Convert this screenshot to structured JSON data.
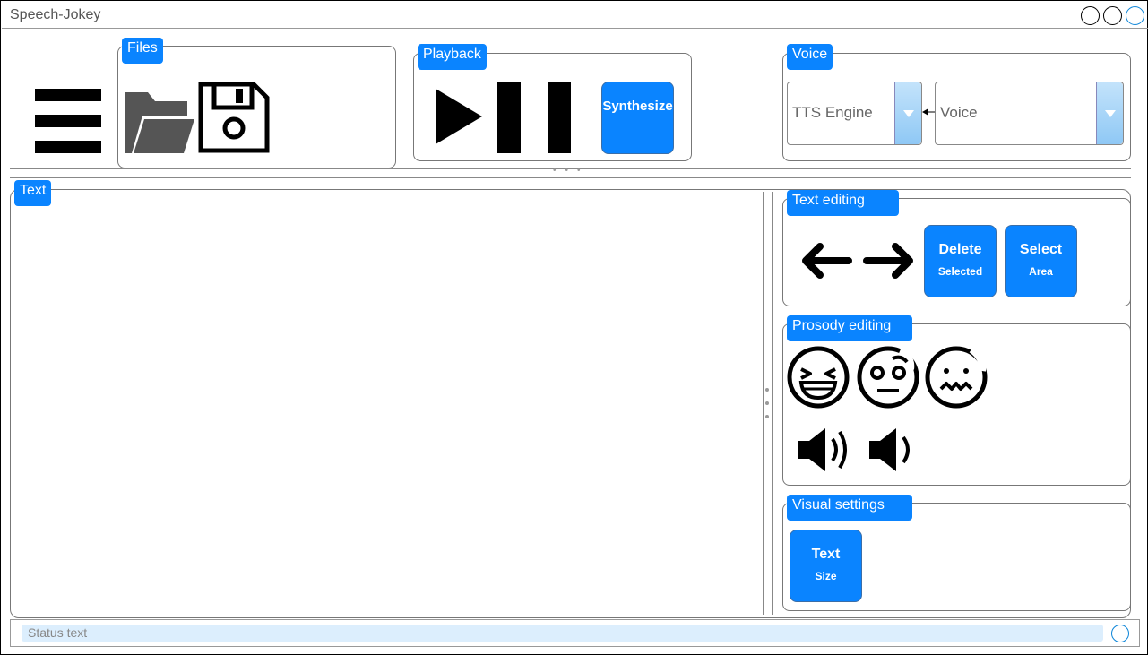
{
  "app": {
    "title": "Speech-Jokey"
  },
  "toolbar": {
    "files": {
      "label": "Files"
    },
    "playback": {
      "label": "Playback",
      "synthesize_label": "Synthesize"
    },
    "voice": {
      "label": "Voice",
      "engine_placeholder": "TTS Engine",
      "voice_placeholder": "Voice"
    }
  },
  "text_panel": {
    "label": "Text",
    "content": ""
  },
  "text_editing": {
    "label": "Text editing",
    "delete_label": "Delete",
    "delete_sub": "Selected",
    "select_label": "Select",
    "select_sub": "Area"
  },
  "prosody_editing": {
    "label": "Prosody editing"
  },
  "visual_settings": {
    "label": "Visual settings",
    "text_label": "Text",
    "text_sub": "Size"
  },
  "status": {
    "placeholder": "Status text"
  },
  "colors": {
    "accent": "#0a84ff",
    "dropdown": "#a8d4f7"
  }
}
